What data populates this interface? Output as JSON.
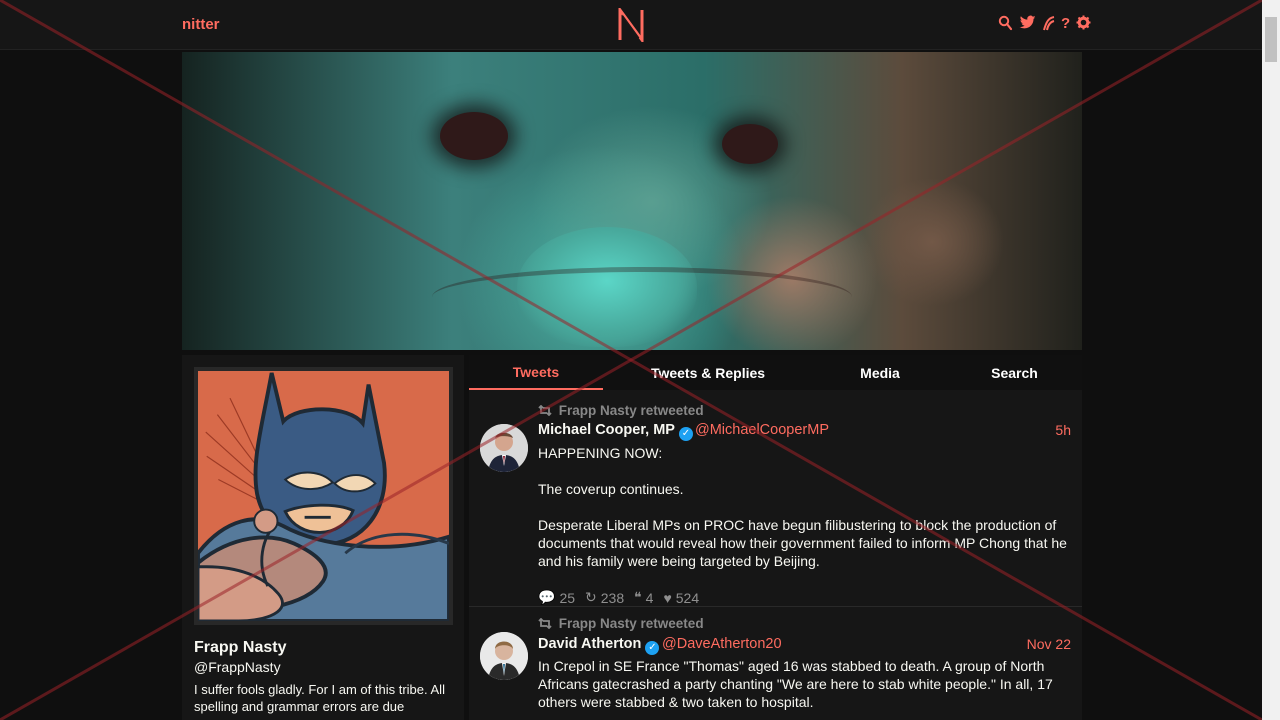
{
  "topnav": {
    "brand": "nitter"
  },
  "profile": {
    "name": "Frapp Nasty",
    "handle": "@FrappNasty",
    "bio": "I suffer fools gladly. For I am of this tribe. All spelling and grammar errors are due"
  },
  "tabs": [
    {
      "label": "Tweets",
      "active": true
    },
    {
      "label": "Tweets & Replies",
      "active": false
    },
    {
      "label": "Media",
      "active": false
    },
    {
      "label": "Search",
      "active": false
    }
  ],
  "tweets": [
    {
      "retweet_label": "Frapp Nasty retweeted",
      "name": "Michael Cooper, MP",
      "handle": "@MichaelCooperMP",
      "date": "5h",
      "content": "HAPPENING NOW:\n\nThe coverup continues.\n\nDesperate Liberal MPs on PROC have begun filibustering to block the production of documents that would reveal how their government failed to inform MP Chong that he and his family were being targeted by Beijing.",
      "stats": {
        "replies": "25",
        "retweets": "238",
        "quotes": "4",
        "likes": "524"
      }
    },
    {
      "retweet_label": "Frapp Nasty retweeted",
      "name": "David Atherton",
      "handle": "@DaveAtherton20",
      "date": "Nov 22",
      "content": "In Crepol in SE France \"Thomas\" aged 16 was stabbed  to death. A group of North Africans gatecrashed a party chanting \"We are here to stab white people.\" In all, 17 others were stabbed & two taken to hospital."
    }
  ],
  "colors": {
    "accent": "#ff6c60",
    "background": "#0f0f0f",
    "panel": "#161616"
  },
  "icons": [
    "search-icon",
    "twitter-icon",
    "rss-icon",
    "help-icon",
    "settings-icon",
    "retweet-icon",
    "comment-icon",
    "quote-icon",
    "heart-icon",
    "verified-icon"
  ]
}
